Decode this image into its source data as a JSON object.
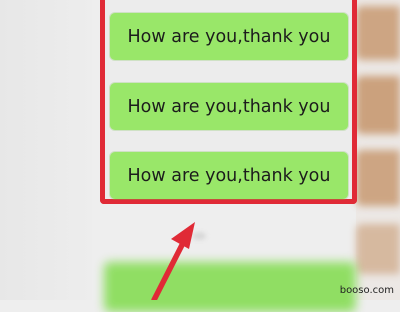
{
  "chat": {
    "messages": [
      {
        "text": "How are you,thank you"
      },
      {
        "text": "How are you,thank you"
      },
      {
        "text": "How are you,thank you"
      }
    ]
  },
  "annotation": {
    "frame_color": "#e02a36",
    "arrow_color": "#e02a36"
  },
  "colors": {
    "bubble": "#99e769",
    "background": "#eeeeee"
  },
  "watermark": {
    "text": "booso.com"
  }
}
